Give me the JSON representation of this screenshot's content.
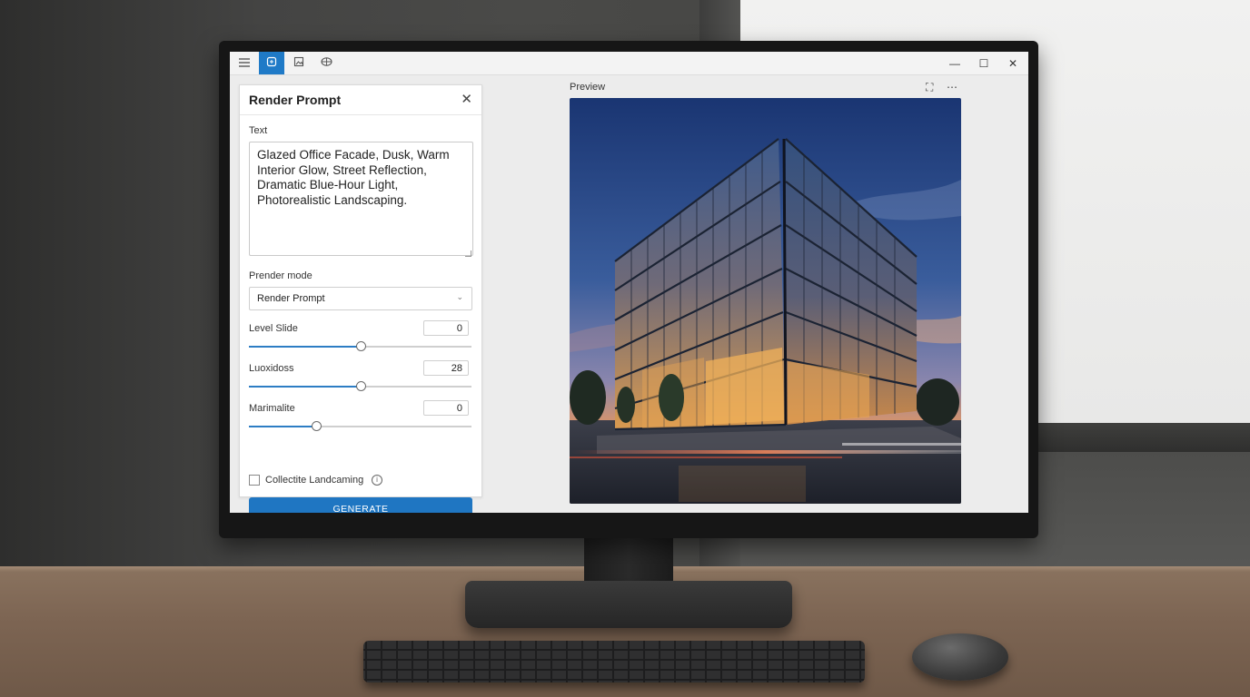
{
  "toolbar": {
    "buttons": [
      {
        "icon": "menu-icon"
      },
      {
        "icon": "render-icon",
        "active": true
      },
      {
        "icon": "image-icon"
      },
      {
        "icon": "3d-view-icon"
      }
    ]
  },
  "window_controls": {
    "minimize": "—",
    "maximize": "☐",
    "close": "✕"
  },
  "panel": {
    "title": "Render Prompt",
    "close_glyph": "✕",
    "text_label": "Text",
    "text_value": "Glazed Office Facade, Dusk, Warm Interior Glow, Street Reflection, Dramatic Blue-Hour Light, Photorealistic Landscaping.",
    "mode_label": "Prender mode",
    "mode_value": "Render Prompt",
    "sliders": [
      {
        "label": "Level Slide",
        "value": "0",
        "level": 0.5
      },
      {
        "label": "Luoxidoss",
        "value": "28",
        "level": 0.5
      },
      {
        "label": "Marimalite",
        "value": "0",
        "level": 0.3
      }
    ],
    "checkbox_label": "Collectite Landcaming",
    "checkbox_checked": false,
    "info_glyph": "i",
    "generate_label": "GENERATE"
  },
  "preview": {
    "label": "Preview",
    "fit_glyph": "⛶",
    "more_glyph": "⋯"
  },
  "colors": {
    "accent": "#1f76c2",
    "sky_top": "#1d3a78",
    "sky_dusk": "#e9915a",
    "window_glow": "#f0b35a"
  }
}
